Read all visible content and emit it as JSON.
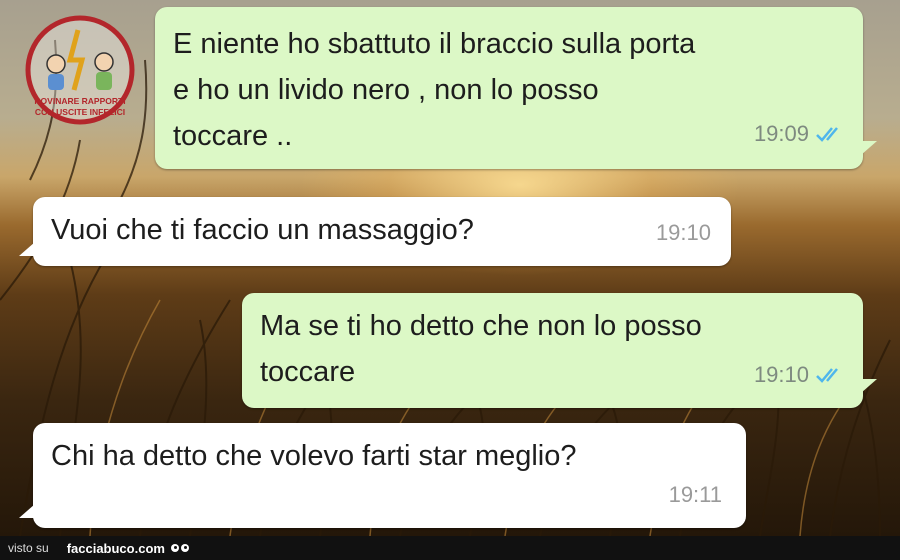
{
  "watermark": {
    "line1": "ROVINARE RAPPORTI",
    "line2": "CON USCITE INFELICI"
  },
  "messages": [
    {
      "direction": "outgoing",
      "text": "E niente ho sbattuto il braccio sulla porta\ne ho un livido nero , non lo posso\ntoccare ..",
      "time": "19:09",
      "status": "read"
    },
    {
      "direction": "incoming",
      "text": "Vuoi che ti faccio un massaggio?",
      "time": "19:10"
    },
    {
      "direction": "outgoing",
      "text": "Ma se ti ho detto che non lo posso\ntoccare",
      "time": "19:10",
      "status": "read"
    },
    {
      "direction": "incoming",
      "text": "Chi ha detto che volevo farti star meglio?",
      "time": "19:11"
    }
  ],
  "footer": {
    "prefix": "visto su",
    "site": "facciabuco.com"
  },
  "colors": {
    "outgoing_bubble": "#dcf8c6",
    "incoming_bubble": "#ffffff",
    "read_ticks": "#4fb6ec",
    "timestamp": "#7e8a80"
  }
}
